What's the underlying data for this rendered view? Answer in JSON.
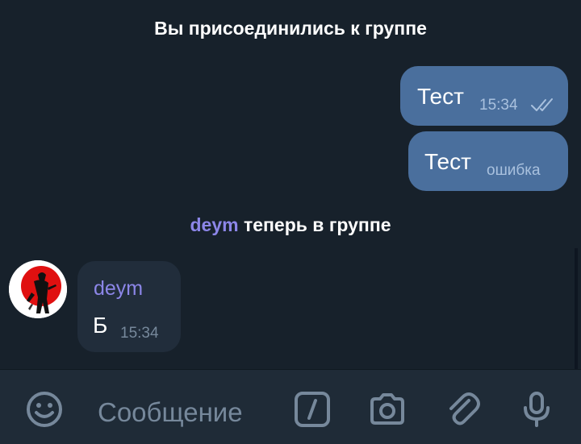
{
  "chat": {
    "service_joined": "Вы присоединились к группе",
    "service_member_name": "deym",
    "service_member_text": "теперь в группе",
    "messages_out": [
      {
        "text": "Тест",
        "time": "15:34",
        "status": "read"
      },
      {
        "text": "Тест",
        "status_text": "ошибка"
      }
    ],
    "message_in": {
      "sender": "deym",
      "text": "Б",
      "time": "15:34"
    }
  },
  "input": {
    "placeholder": "Сообщение"
  },
  "icons": {
    "emoji": "smile-icon",
    "commands": "slash-command-icon",
    "camera": "camera-icon",
    "attach": "paperclip-icon",
    "mic": "microphone-icon",
    "read": "double-check-icon"
  },
  "colors": {
    "background": "#17212b",
    "outgoing_bubble": "#4a6f9d",
    "incoming_bubble": "#212d3b",
    "name_accent": "#8c86e8",
    "input_bar": "#1f2b37"
  }
}
